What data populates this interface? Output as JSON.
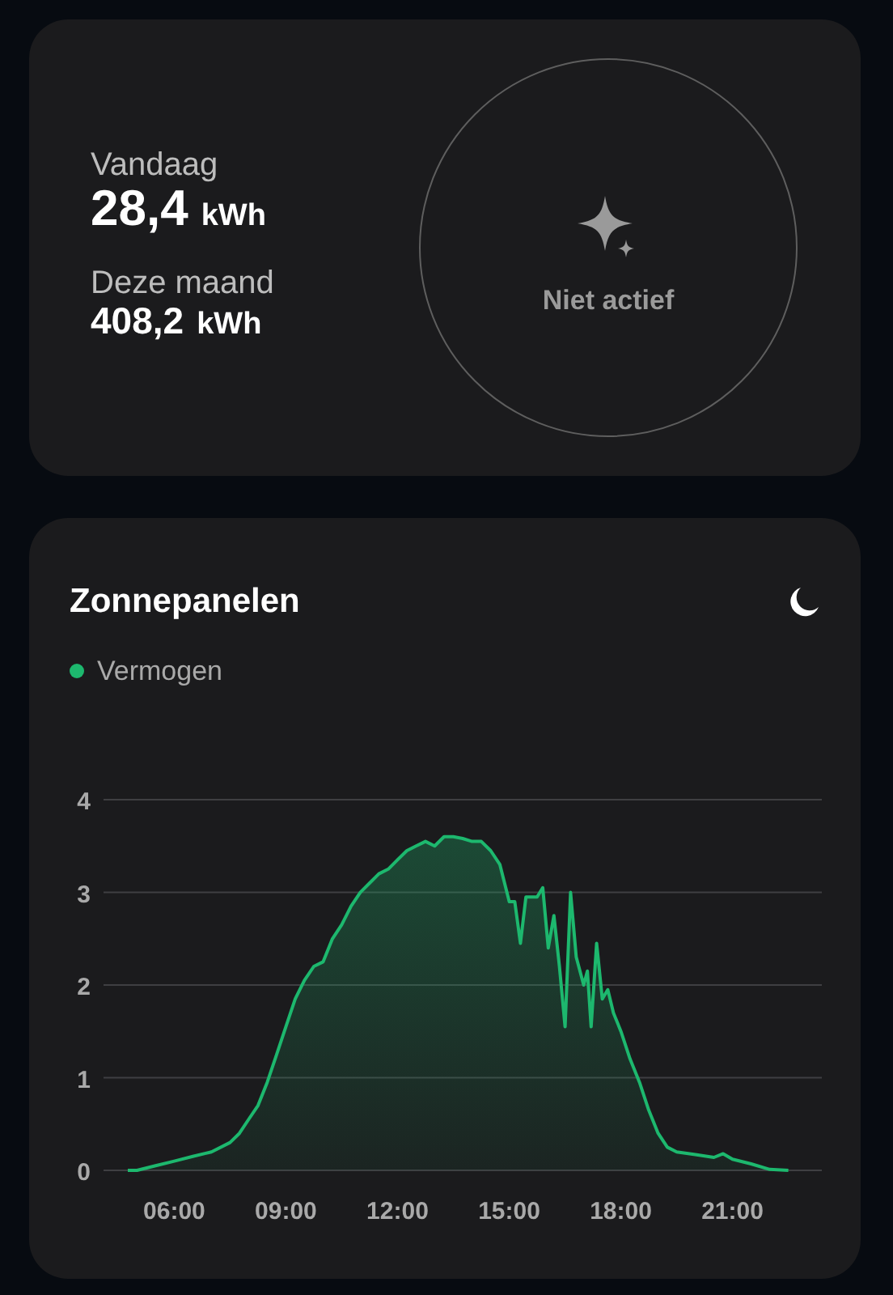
{
  "summary": {
    "stats": [
      {
        "label": "Vandaag",
        "value": "28,4",
        "unit": "kWh",
        "kind": "large"
      },
      {
        "label": "Deze maand",
        "value": "408,2",
        "unit": "kWh",
        "kind": "medium"
      }
    ],
    "status": {
      "text": "Niet actief",
      "active": false
    }
  },
  "solar_card": {
    "title": "Zonnepanelen",
    "chart_data": {
      "type": "area",
      "grid": true,
      "xlim": [
        4.1,
        23.4
      ],
      "ylim": [
        0,
        4
      ],
      "yticks": [
        0,
        1,
        2,
        3,
        4
      ],
      "xticks": [
        {
          "value": 6,
          "label": "06:00"
        },
        {
          "value": 9,
          "label": "09:00"
        },
        {
          "value": 12,
          "label": "12:00"
        },
        {
          "value": 15,
          "label": "15:00"
        },
        {
          "value": 18,
          "label": "18:00"
        },
        {
          "value": 21,
          "label": "21:00"
        }
      ],
      "x": [
        4.75,
        5.0,
        5.5,
        6.0,
        6.5,
        7.0,
        7.5,
        7.75,
        8.0,
        8.25,
        8.5,
        8.75,
        9.0,
        9.25,
        9.5,
        9.75,
        10.0,
        10.25,
        10.5,
        10.75,
        11.0,
        11.25,
        11.5,
        11.75,
        12.0,
        12.25,
        12.5,
        12.75,
        13.0,
        13.25,
        13.5,
        13.75,
        14.0,
        14.25,
        14.5,
        14.75,
        15.0,
        15.15,
        15.3,
        15.45,
        15.75,
        15.9,
        16.05,
        16.2,
        16.35,
        16.5,
        16.65,
        16.8,
        17.0,
        17.1,
        17.2,
        17.35,
        17.5,
        17.65,
        17.8,
        18.0,
        18.25,
        18.5,
        18.75,
        19.0,
        19.25,
        19.5,
        20.0,
        20.5,
        20.75,
        21.0,
        21.5,
        22.0,
        22.5
      ],
      "series": [
        {
          "name": "Vermogen",
          "color": "#1db86e",
          "values": [
            0,
            0,
            0.05,
            0.1,
            0.15,
            0.2,
            0.3,
            0.4,
            0.55,
            0.7,
            0.95,
            1.25,
            1.55,
            1.85,
            2.05,
            2.2,
            2.25,
            2.5,
            2.65,
            2.85,
            3.0,
            3.1,
            3.2,
            3.25,
            3.35,
            3.45,
            3.5,
            3.55,
            3.5,
            3.6,
            3.6,
            3.58,
            3.55,
            3.55,
            3.45,
            3.3,
            2.9,
            2.9,
            2.45,
            2.95,
            2.95,
            3.05,
            2.4,
            2.75,
            2.2,
            1.55,
            3.0,
            2.3,
            2.0,
            2.15,
            1.55,
            2.45,
            1.85,
            1.95,
            1.7,
            1.5,
            1.2,
            0.95,
            0.65,
            0.4,
            0.25,
            0.2,
            0.17,
            0.14,
            0.18,
            0.12,
            0.07,
            0.01,
            0
          ]
        }
      ]
    }
  }
}
